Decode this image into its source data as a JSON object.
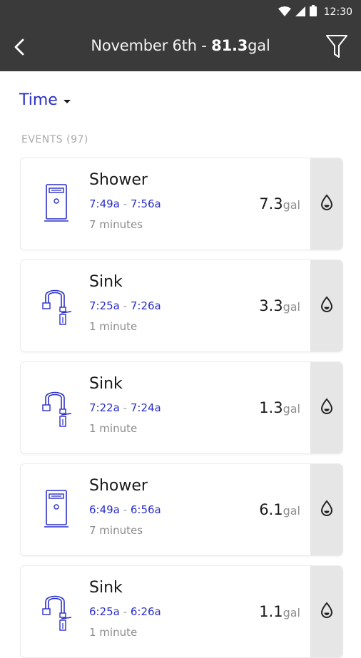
{
  "status_bar": {
    "time": "12:30"
  },
  "header": {
    "date": "November 6th",
    "separator": " - ",
    "total_value": "81.3",
    "total_unit": "gal"
  },
  "sort": {
    "label": "Time"
  },
  "events_section": {
    "label": "EVENTS (97)"
  },
  "events": [
    {
      "type": "Shower",
      "icon": "shower-icon",
      "start": "7:49a",
      "end": "7:56a",
      "duration": "7 minutes",
      "volume": "7.3",
      "unit": "gal"
    },
    {
      "type": "Sink",
      "icon": "faucet-icon",
      "start": "7:25a",
      "end": "7:26a",
      "duration": "1 minute",
      "volume": "3.3",
      "unit": "gal"
    },
    {
      "type": "Sink",
      "icon": "faucet-icon",
      "start": "7:22a",
      "end": "7:24a",
      "duration": "1 minute",
      "volume": "1.3",
      "unit": "gal"
    },
    {
      "type": "Shower",
      "icon": "shower-icon",
      "start": "6:49a",
      "end": "6:56a",
      "duration": "7 minutes",
      "volume": "6.1",
      "unit": "gal"
    },
    {
      "type": "Sink",
      "icon": "faucet-icon",
      "start": "6:25a",
      "end": "6:26a",
      "duration": "1 minute",
      "volume": "1.1",
      "unit": "gal"
    }
  ],
  "colors": {
    "accent": "#2a2fc9",
    "appbar": "#3a3a3a",
    "action_panel": "#e6e6e6"
  }
}
